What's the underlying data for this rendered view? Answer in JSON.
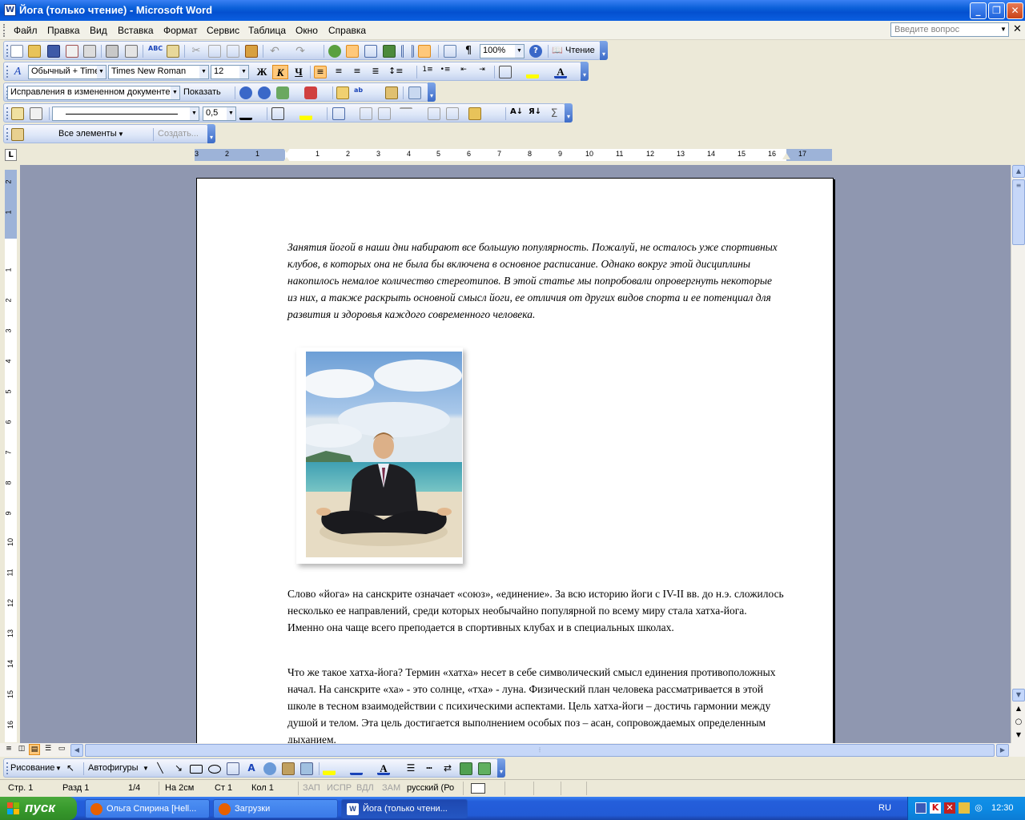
{
  "window": {
    "title": "Йога (только чтение) - Microsoft Word",
    "app_icon_letter": "W"
  },
  "menu": [
    "Файл",
    "Правка",
    "Вид",
    "Вставка",
    "Формат",
    "Сервис",
    "Таблица",
    "Окно",
    "Справка"
  ],
  "help_box": {
    "placeholder": "Введите вопрос"
  },
  "standard_toolbar": {
    "zoom": "100%",
    "reading_label": "Чтение"
  },
  "formatting_toolbar": {
    "style": "Обычный + Time",
    "font": "Times New Roman",
    "size": "12",
    "bold": "Ж",
    "italic": "К",
    "underline": "Ч"
  },
  "reviewing_toolbar": {
    "display_mode": "Исправления в измененном документе",
    "show_label": "Показать"
  },
  "tables_toolbar": {
    "line_weight": "0,5",
    "sum": "Σ"
  },
  "frames_toolbar": {
    "all_elements": "Все элементы",
    "create": "Создать..."
  },
  "ruler": {
    "horizontal_numbers": [
      "3",
      "2",
      "1",
      "1",
      "2",
      "3",
      "4",
      "5",
      "6",
      "7",
      "8",
      "9",
      "10",
      "11",
      "12",
      "13",
      "14",
      "15",
      "16",
      "17"
    ],
    "vertical_numbers": [
      "2",
      "1",
      "1",
      "2",
      "3",
      "4",
      "5",
      "6",
      "7",
      "8",
      "9",
      "10",
      "11",
      "12",
      "13",
      "14",
      "15",
      "16"
    ]
  },
  "document": {
    "intro": "Занятия йогой в наши дни набирают все большую популярность. Пожалуй, не осталось уже спортивных клубов, в которых она не была бы включена в основное расписание. Однако вокруг этой дисциплины  накопилось немалое количество стереотипов. В этой статье мы попробовали опровергнуть некоторые из них, а также раскрыть основной смысл йоги, ее отличия от других видов спорта и ее потенциал для развития и здоровья каждого современного человека.",
    "paragraph1": "Слово «йога» на санскрите означает «союз», «единение».  За всю историю йоги с IV-II вв. до н.э. сложилось несколько ее направлений, среди которых необычайно популярной по всему миру стала хатха-йога. Именно она чаще всего преподается в спортивных клубах и в специальных школах.",
    "paragraph2": "Что же такое хатха-йога?  Термин «хатха» несет в себе символический смысл единения противоположных начал. На санскрите «ха»  - это солнце, «тха» - луна.  Физический план человека рассматривается в этой школе в тесном взаимодействии с психическими аспектами. Цель хатха-йоги – достичь гармонии между душой и телом. Эта цель достигается  выполнением особых поз – асан, сопровождаемых определенным дыханием."
  },
  "drawing_toolbar": {
    "draw_label": "Рисование",
    "autoshapes_label": "Автофигуры"
  },
  "status": {
    "page": "Стр. 1",
    "section": "Разд 1",
    "pages": "1/4",
    "at": "На 2см",
    "line": "Ст 1",
    "col": "Кол 1",
    "rec": "ЗАП",
    "trk": "ИСПР",
    "ext": "ВДЛ",
    "ovr": "ЗАМ",
    "lang": "русский (Ро"
  },
  "taskbar": {
    "start": "пуск",
    "tasks": [
      "Ольга Спирина [Hell...",
      "Загрузки",
      "Йога (только чтени..."
    ],
    "lang": "RU",
    "clock": "12:30"
  }
}
